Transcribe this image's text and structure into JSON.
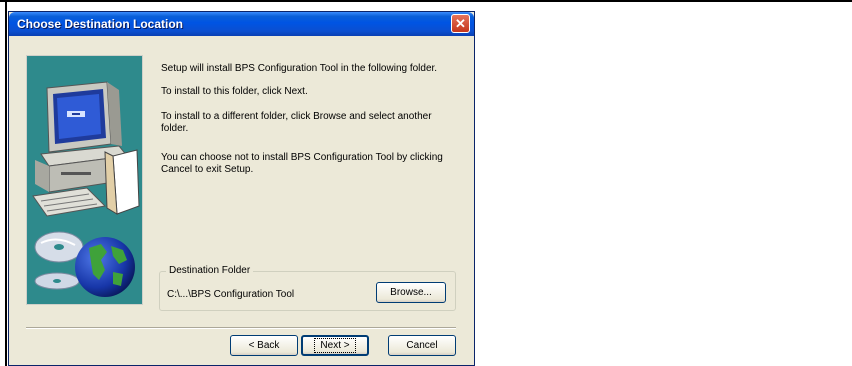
{
  "window": {
    "title": "Choose Destination Location",
    "close_glyph": "✕"
  },
  "body": {
    "line1": "Setup will install BPS Configuration Tool in the following folder.",
    "line2": "To install to this folder, click Next.",
    "line3": "To install to a different folder, click Browse and select another folder.",
    "line4": "You can choose not to install BPS Configuration Tool by clicking Cancel to exit Setup."
  },
  "destination": {
    "legend": "Destination Folder",
    "path": "C:\\...\\BPS Configuration Tool",
    "browse_label": "Browse..."
  },
  "buttons": {
    "back_label": "< Back",
    "next_label": "Next >",
    "cancel_label": "Cancel"
  },
  "art": {
    "icons": [
      "computer-icon",
      "cd-disc-icon",
      "globe-icon"
    ],
    "background_color": "#2e8a8c"
  }
}
